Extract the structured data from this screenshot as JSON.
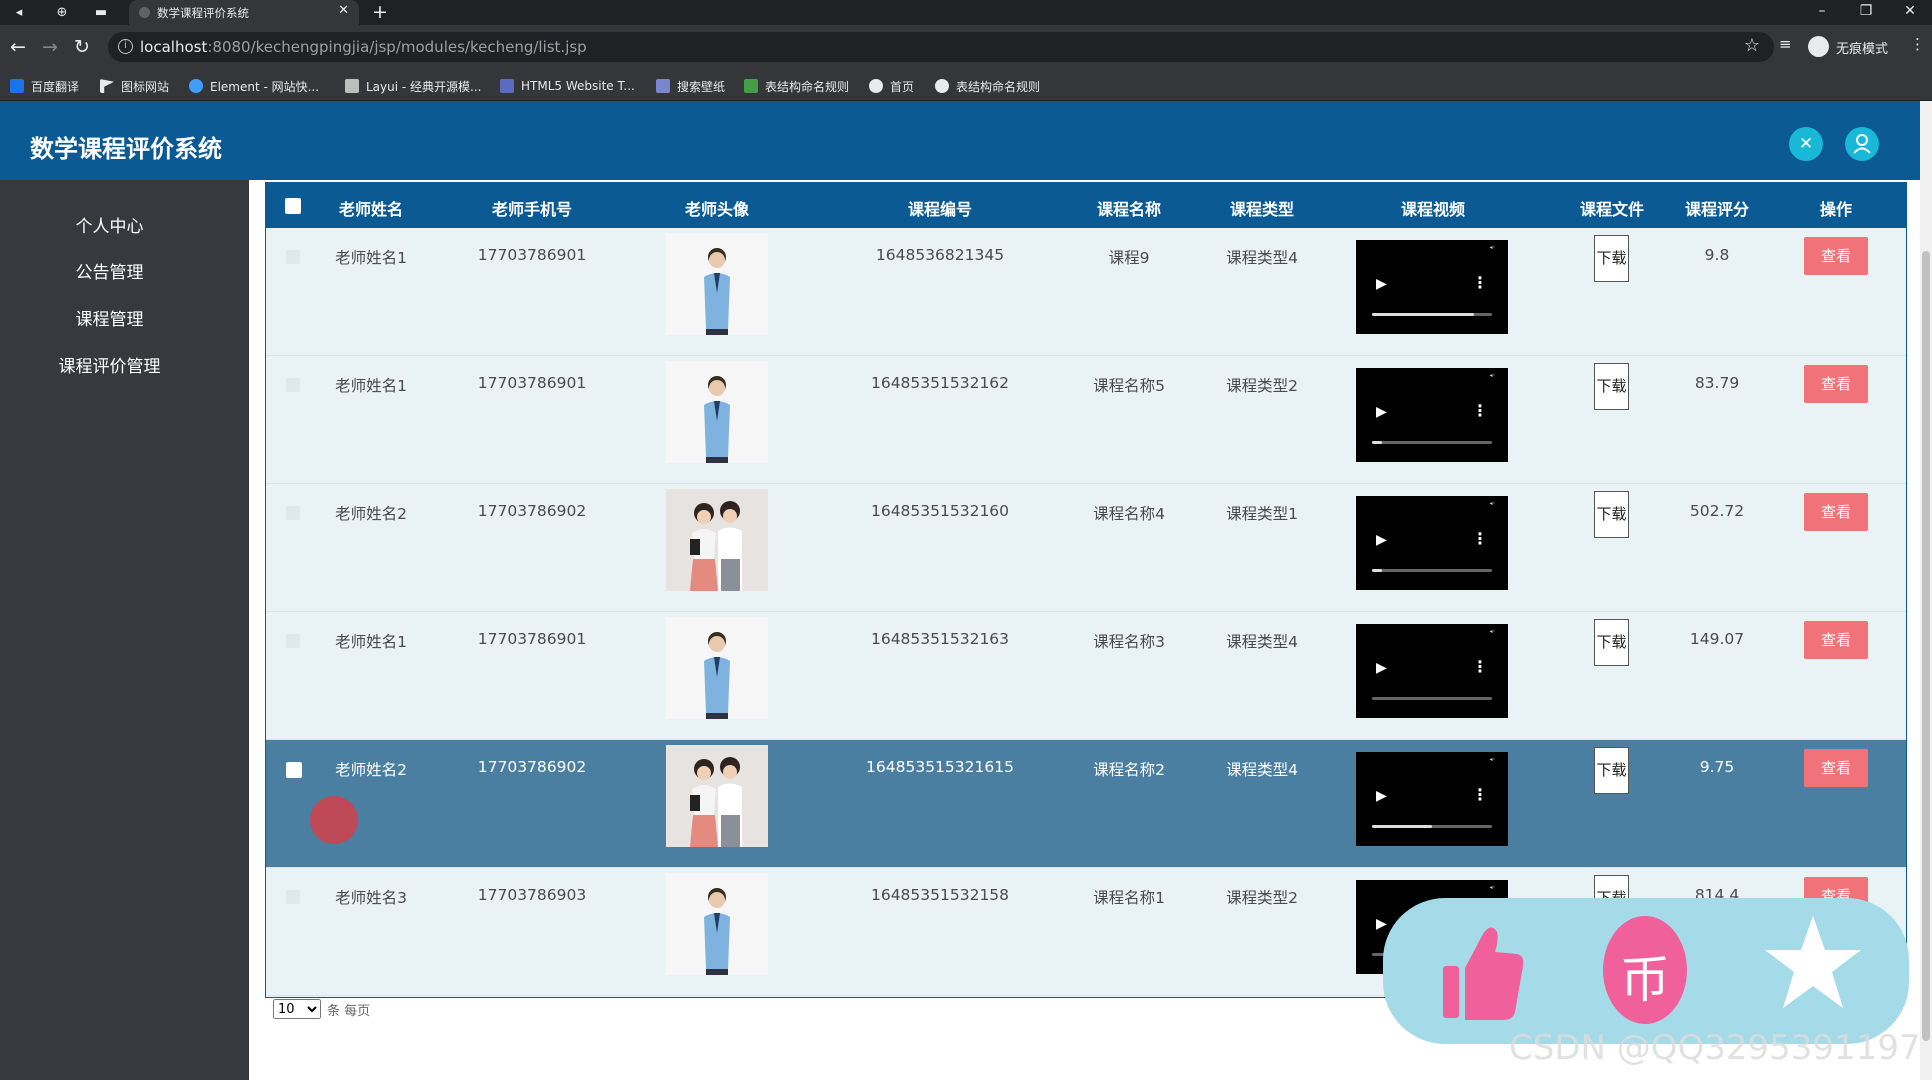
{
  "browser": {
    "tab_title": "数学课程评价系统",
    "url_host": "localhost",
    "url_path": ":8080/kechengpingjia/jsp/modules/kecheng/list.jsp",
    "incognito_label": "无痕模式",
    "bookmarks": [
      {
        "label": "百度翻译",
        "icon_color": "#1a73e8"
      },
      {
        "label": "图标网站",
        "icon_color": "#ffffff"
      },
      {
        "label": "Element - 网站快...",
        "icon_color": "#409eff"
      },
      {
        "label": "Layui - 经典开源模...",
        "icon_color": "#bdbdbd"
      },
      {
        "label": "HTML5 Website T...",
        "icon_color": "#5c6bc0"
      },
      {
        "label": "搜索壁纸",
        "icon_color": "#7986cb"
      },
      {
        "label": "表结构命名规则",
        "icon_color": "#43a047"
      },
      {
        "label": "首页",
        "icon_color": "#e8eaed"
      },
      {
        "label": "表结构命名规则",
        "icon_color": "#e8eaed"
      }
    ]
  },
  "app": {
    "title": "数学课程评价系统",
    "accent_color": "#0b5a94",
    "sidebar": {
      "items": [
        {
          "label": "个人中心"
        },
        {
          "label": "公告管理"
        },
        {
          "label": "课程管理"
        },
        {
          "label": "课程评价管理"
        }
      ]
    },
    "table": {
      "columns": [
        "老师姓名",
        "老师手机号",
        "老师头像",
        "课程编号",
        "课程名称",
        "课程类型",
        "课程视频",
        "课程文件",
        "课程评分",
        "操作"
      ],
      "download_label": "下载",
      "view_label": "查看",
      "rows": [
        {
          "name": "老师姓名1",
          "phone": "17703786901",
          "avatar": "single",
          "code": "1648536821345",
          "course": "课程9",
          "type": "课程类型4",
          "video_progress": 0.85,
          "score": "9.8",
          "selected": false
        },
        {
          "name": "老师姓名1",
          "phone": "17703786901",
          "avatar": "single",
          "code": "16485351532162",
          "course": "课程名称5",
          "type": "课程类型2",
          "video_progress": 0.08,
          "score": "83.79",
          "selected": false
        },
        {
          "name": "老师姓名2",
          "phone": "17703786902",
          "avatar": "pair",
          "code": "16485351532160",
          "course": "课程名称4",
          "type": "课程类型1",
          "video_progress": 0.08,
          "score": "502.72",
          "selected": false
        },
        {
          "name": "老师姓名1",
          "phone": "17703786901",
          "avatar": "single",
          "code": "16485351532163",
          "course": "课程名称3",
          "type": "课程类型4",
          "video_progress": 0.0,
          "score": "149.07",
          "selected": false
        },
        {
          "name": "老师姓名2",
          "phone": "17703786902",
          "avatar": "pair",
          "code": "164853515321615",
          "course": "课程名称2",
          "type": "课程类型4",
          "video_progress": 0.5,
          "score": "9.75",
          "selected": true
        },
        {
          "name": "老师姓名3",
          "phone": "17703786903",
          "avatar": "single",
          "code": "16485351532158",
          "course": "课程名称1",
          "type": "课程类型2",
          "video_progress": 0.0,
          "score": "814.4",
          "selected": false
        }
      ]
    },
    "pager": {
      "page_size": "10",
      "suffix": "条 每页"
    }
  },
  "overlay": {
    "coin_char": "币",
    "watermark": "CSDN @QQ3295391197",
    "colors": {
      "panel": "#a5dbe9",
      "pink": "#f0609a"
    }
  }
}
